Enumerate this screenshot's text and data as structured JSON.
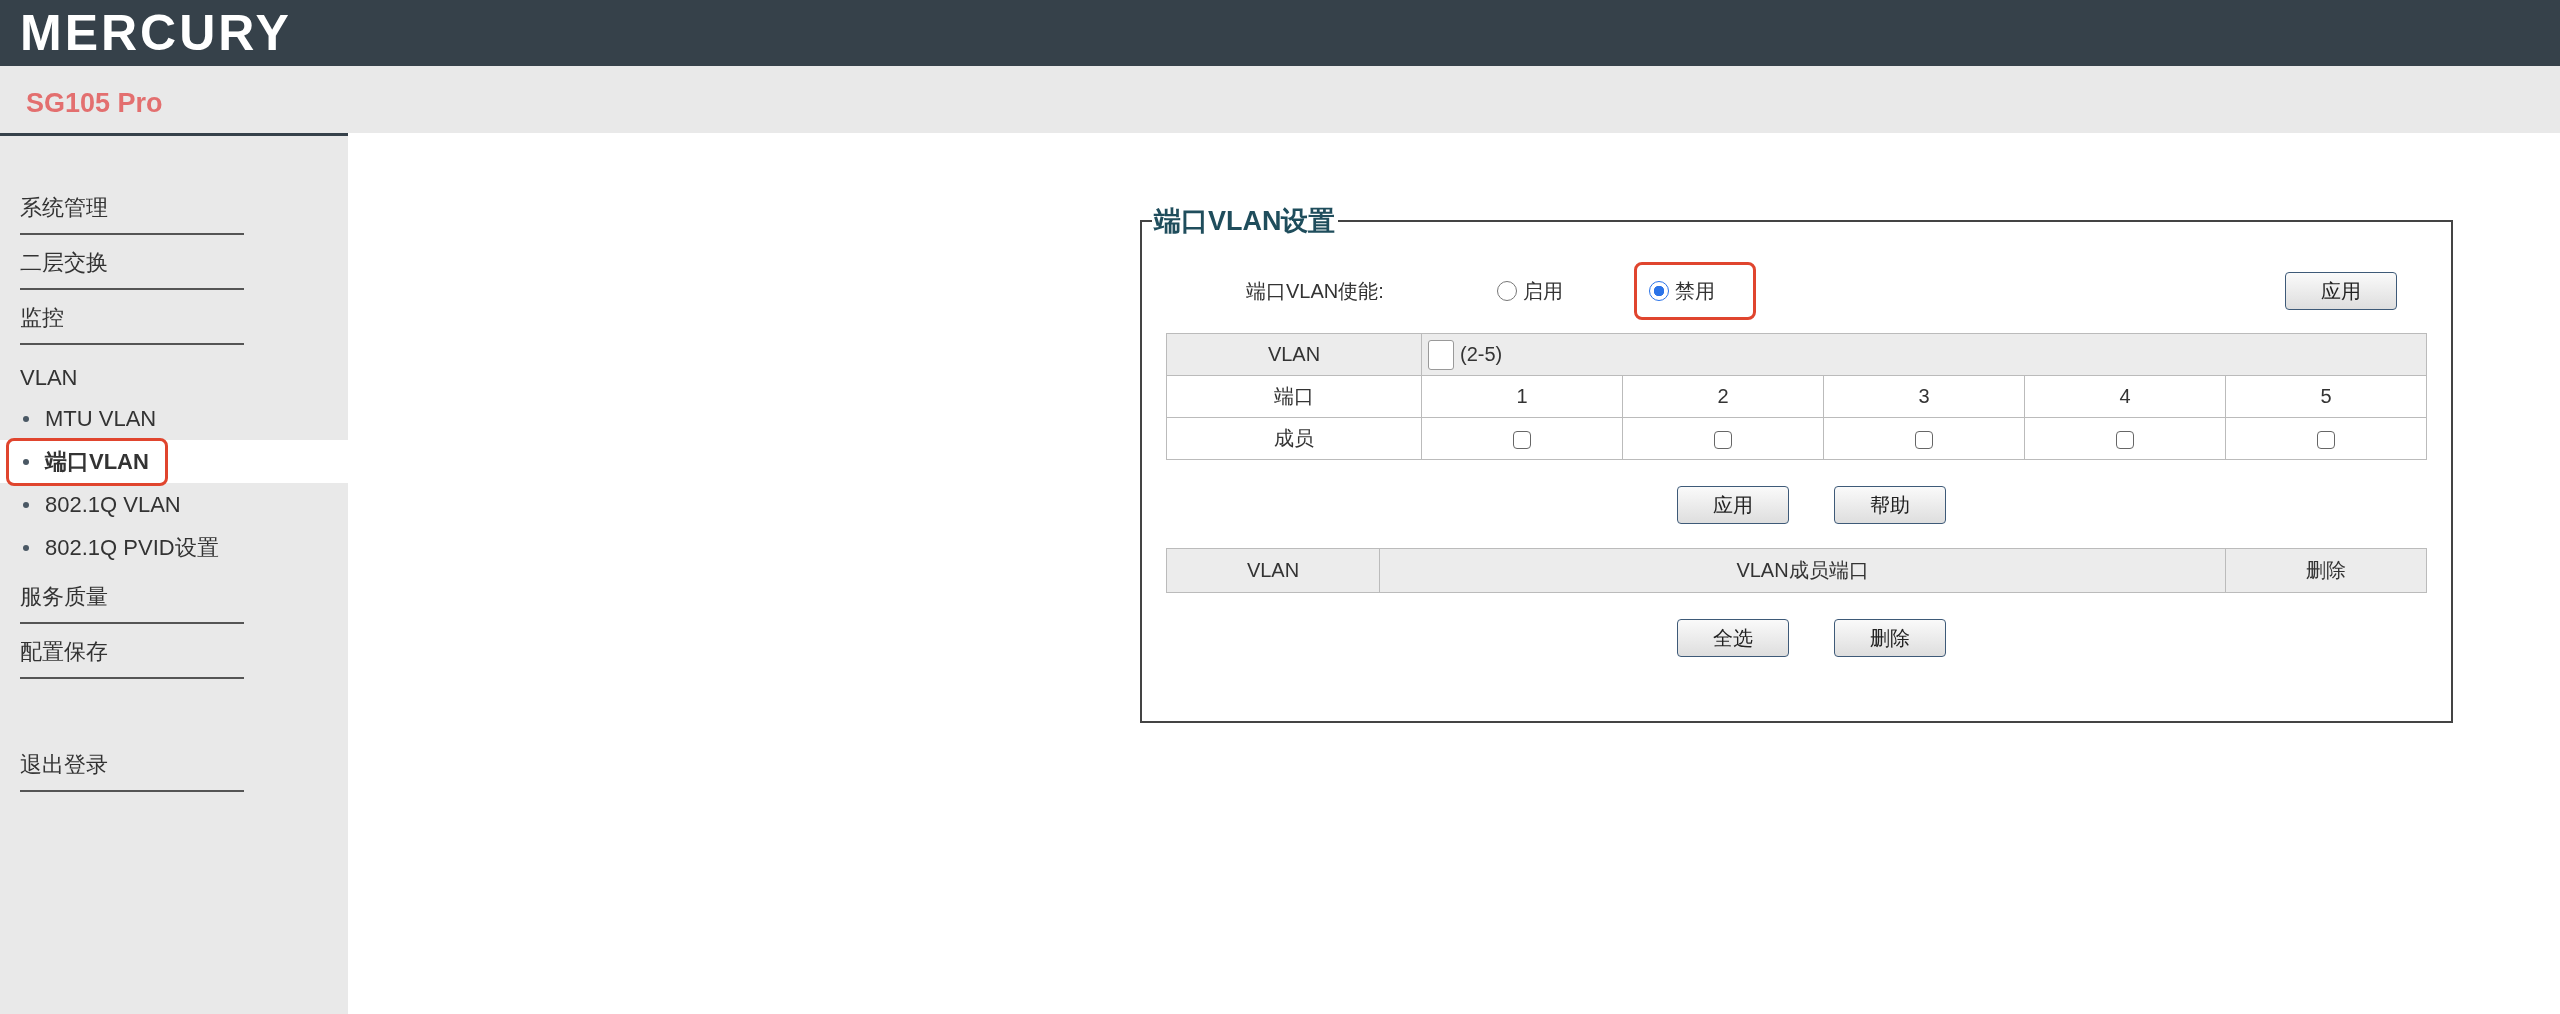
{
  "header": {
    "logo": "MERCURY",
    "model": "SG105 Pro"
  },
  "sidebar": {
    "items": [
      {
        "label": "系统管理",
        "kind": "section",
        "selected": false,
        "highlighted": false
      },
      {
        "label": "二层交换",
        "kind": "section",
        "selected": false,
        "highlighted": false
      },
      {
        "label": "监控",
        "kind": "section",
        "selected": false,
        "highlighted": false
      },
      {
        "label": "VLAN",
        "kind": "group",
        "selected": false,
        "highlighted": false
      },
      {
        "label": "MTU VLAN",
        "kind": "sub",
        "selected": false,
        "highlighted": false
      },
      {
        "label": "端口VLAN",
        "kind": "sub",
        "selected": true,
        "highlighted": true
      },
      {
        "label": "802.1Q VLAN",
        "kind": "sub",
        "selected": false,
        "highlighted": false
      },
      {
        "label": "802.1Q PVID设置",
        "kind": "sub",
        "selected": false,
        "highlighted": false
      },
      {
        "label": "服务质量",
        "kind": "section",
        "selected": false,
        "highlighted": false
      },
      {
        "label": "配置保存",
        "kind": "section",
        "selected": false,
        "highlighted": false
      }
    ],
    "logout": "退出登录"
  },
  "panel": {
    "title": "端口VLAN设置",
    "enable": {
      "label": "端口VLAN使能:",
      "options": [
        {
          "label": "启用",
          "selected": false,
          "highlighted": false
        },
        {
          "label": "禁用",
          "selected": true,
          "highlighted": true
        }
      ],
      "apply_button": "应用"
    },
    "vlan_table": {
      "vlan_label": "VLAN",
      "range_hint": "(2-5)",
      "port_label": "端口",
      "member_label": "成员",
      "ports": [
        {
          "label": "1",
          "checked": false
        },
        {
          "label": "2",
          "checked": false
        },
        {
          "label": "3",
          "checked": false
        },
        {
          "label": "4",
          "checked": false
        },
        {
          "label": "5",
          "checked": false
        }
      ]
    },
    "buttons": [
      "应用",
      "帮助"
    ],
    "list_table": {
      "columns": [
        "VLAN",
        "VLAN成员端口",
        "删除"
      ]
    },
    "list_buttons": [
      "全选",
      "删除"
    ]
  }
}
